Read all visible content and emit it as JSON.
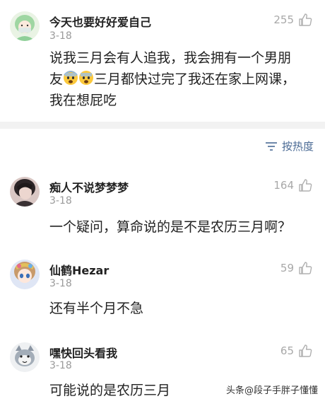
{
  "comments": [
    {
      "username": "今天也要好好爱自己",
      "date": "3-18",
      "likes": "255",
      "text_line1": "说我三月会有人追我，我会拥有一个男朋",
      "text_line2a": "友",
      "text_line2b": "三月都快过完了我还在家上网课，",
      "text_line3": "我在想屁吃",
      "emoji": "fearful-face-emoji",
      "avatar_icon": "green-hair-girl-avatar"
    },
    {
      "username": "痴人不说梦梦梦",
      "date": "3-18",
      "likes": "164",
      "text": "一个疑问，算命说的是不是农历三月啊？",
      "avatar_icon": "dark-hair-photo-avatar"
    },
    {
      "username": "仙鹤Hezar",
      "date": "3-18",
      "likes": "59",
      "text": "还有半个月不急",
      "avatar_icon": "anime-girl-avatar"
    },
    {
      "username": "嘿快回头看我",
      "date": "3-18",
      "likes": "65",
      "text": "可能说的是农历三月",
      "avatar_icon": "cartoon-cat-avatar"
    }
  ],
  "sort": {
    "label": "按热度",
    "icon": "sort-lines-icon"
  },
  "watermark": "头条@段子手胖子懂懂",
  "colors": {
    "link_blue": "#4a6a94",
    "meta_gray": "#9a9a9a",
    "divider": "#f2f2f2"
  },
  "like_icon": "thumbs-up-icon"
}
